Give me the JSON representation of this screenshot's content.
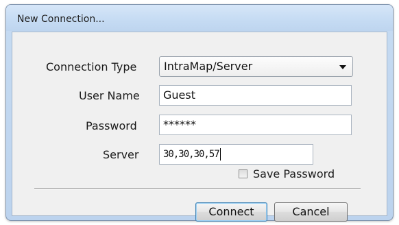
{
  "window": {
    "title": "New Connection..."
  },
  "form": {
    "connection_type_label": "Connection Type",
    "connection_type_value": "IntraMap/Server",
    "user_name_label": "User Name",
    "user_name_value": "Guest",
    "password_label": "Password",
    "password_value": "******",
    "server_label": "Server",
    "server_value": "30,30,30,57",
    "save_password_label": "Save Password",
    "save_password_checked": false
  },
  "buttons": {
    "connect_label": "Connect",
    "cancel_label": "Cancel"
  },
  "icons": {
    "dropdown": "chevron-down-icon",
    "checkbox": "checkbox-icon"
  },
  "colors": {
    "frame": "#c6dbf2",
    "client": "#f0f0f0",
    "default_button_border": "#3c7fb1"
  }
}
